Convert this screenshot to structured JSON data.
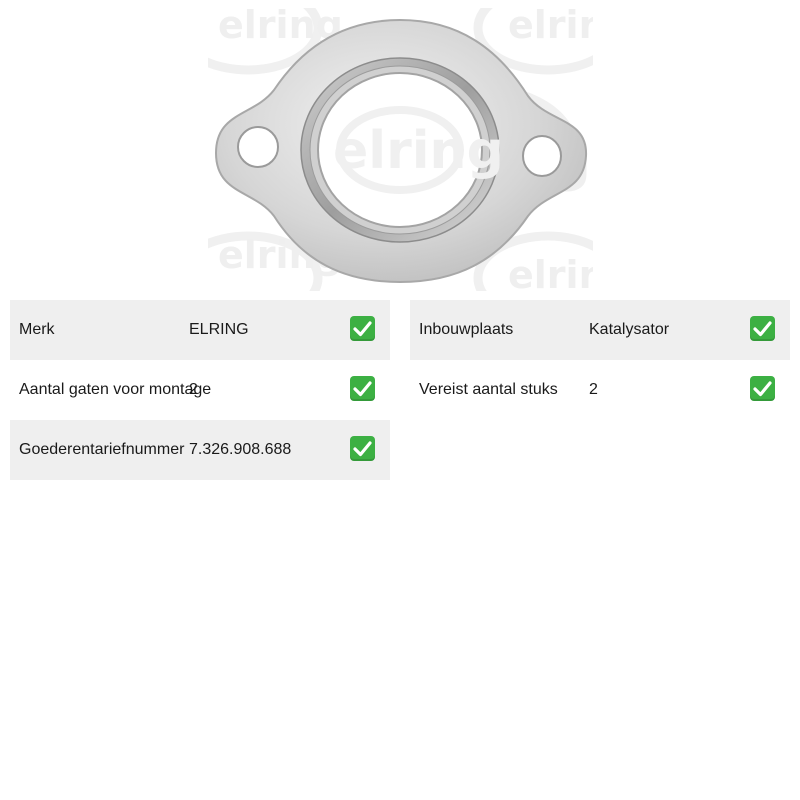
{
  "product": {
    "image_alt": "ELRING exhaust gasket",
    "watermark_text": "elring"
  },
  "specs_left": [
    {
      "label": "Merk",
      "value": "ELRING",
      "icon": "check-icon",
      "shaded": true
    },
    {
      "label": "Aantal gaten voor montage",
      "value": "2",
      "icon": "check-icon",
      "shaded": false
    },
    {
      "label": "Goederentariefnummer",
      "value": "7.326.908.688",
      "icon": "check-icon",
      "shaded": true
    }
  ],
  "specs_right": [
    {
      "label": "Inbouwplaats",
      "value": "Katalysator",
      "icon": "check-icon",
      "shaded": true
    },
    {
      "label": "Vereist aantal stuks",
      "value": "2",
      "icon": "check-icon",
      "shaded": false
    }
  ],
  "colors": {
    "row_shade": "#efefef",
    "check_green": "#3cb043"
  }
}
